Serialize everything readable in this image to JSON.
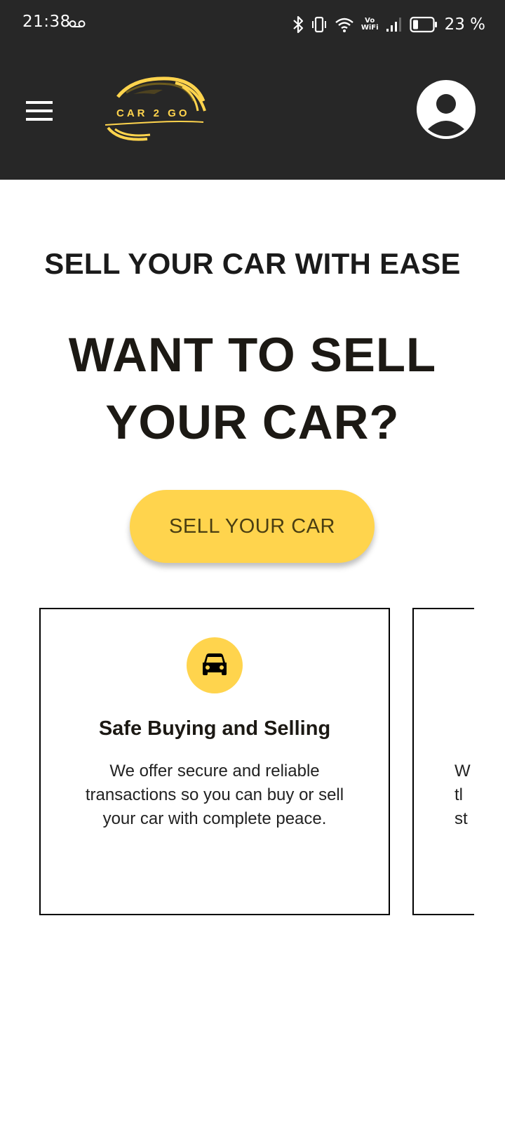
{
  "status_bar": {
    "time": "21:38",
    "vo_label": "Vo",
    "wifi_label": "WiFi",
    "battery": "23 %",
    "icons": [
      "voicemail-icon",
      "bluetooth-icon",
      "vibrate-icon",
      "wifi-icon",
      "signal-icon",
      "battery-icon"
    ]
  },
  "app_bar": {
    "menu_icon": "hamburger-menu-icon",
    "logo_text": "CAR 2 GO",
    "profile_icon": "account-circle-icon",
    "background": "#272727"
  },
  "hero": {
    "subtitle": "SELL YOUR CAR WITH EASE",
    "headline_line1": "WANT TO SELL",
    "headline_line2": "YOUR CAR?",
    "cta_label": "SELL YOUR CAR",
    "accent": "#ffd44d"
  },
  "features": [
    {
      "icon": "car-icon",
      "title": "Safe Buying and Selling",
      "line1": "We offer secure and reliable",
      "line2": "transactions so you can buy or sell",
      "line3": "your car with complete peace."
    },
    {
      "line1": "W",
      "line2": "tl",
      "line3": "st"
    }
  ]
}
